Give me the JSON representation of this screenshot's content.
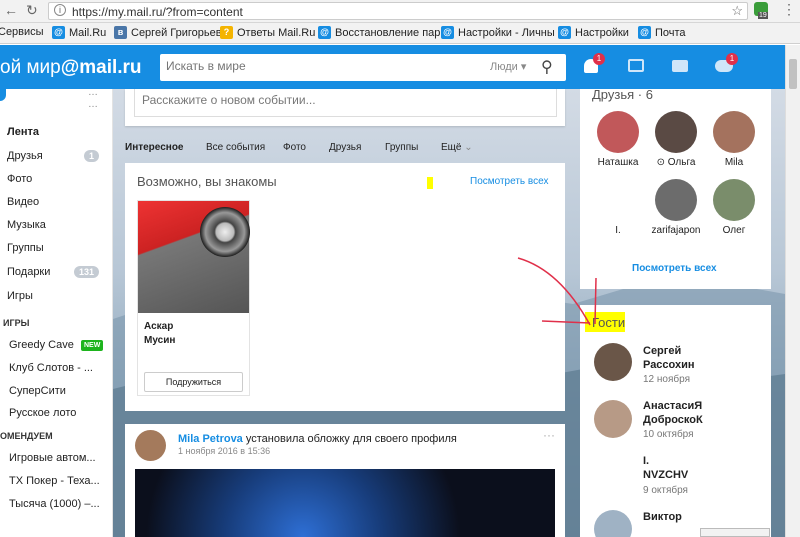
{
  "browser": {
    "url": "https://my.mail.ru/?from=content",
    "bookmarks": [
      "Сервисы",
      "Mail.Ru",
      "Сергей Григорьев",
      "Ответы Mail.Ru",
      "Восстановление пар",
      "Настройки - Личны",
      "Настройки",
      "Почта"
    ],
    "ext_count": "19"
  },
  "header": {
    "logo_prefix": "ой мир",
    "logo_mail": "@mail.ru",
    "search_placeholder": "Искать в мире",
    "search_scope": "Люди",
    "notif_count": "1",
    "games_count": "1"
  },
  "sidebar": {
    "items": [
      {
        "label": "Лента",
        "badge": ""
      },
      {
        "label": "Друзья",
        "badge": "1"
      },
      {
        "label": "Фото",
        "badge": ""
      },
      {
        "label": "Видео",
        "badge": ""
      },
      {
        "label": "Музыка",
        "badge": ""
      },
      {
        "label": "Группы",
        "badge": ""
      },
      {
        "label": "Подарки",
        "badge": "131"
      },
      {
        "label": "Игры",
        "badge": ""
      }
    ],
    "games_header": "ИГРЫ",
    "games": [
      "Greedy Cave",
      "Клуб Слотов - ...",
      "СуперСити",
      "Русское лото"
    ],
    "new_badge": "NEW",
    "recommend_header": "ОМЕНДУЕМ",
    "recommend": [
      "Игровые автом...",
      "ТХ Покер - Теха...",
      "Тысяча (1000) –..."
    ]
  },
  "composer": {
    "placeholder": "Расскажите о новом событии..."
  },
  "tabs": [
    "Интересное",
    "Все события",
    "Фото",
    "Друзья",
    "Группы",
    "Ещё"
  ],
  "maybe_known": {
    "title": "Возможно, вы знакомы",
    "see_all": "Посмотреть всех",
    "person_first": "Аскар",
    "person_last": "Мусин",
    "join_button": "Подружиться"
  },
  "post": {
    "author": "Mila Petrova",
    "action": "установила обложку для своего профиля",
    "date": "1 ноября 2016 в 15:36"
  },
  "friends": {
    "title": "Друзья",
    "count": "6",
    "list": [
      "Наташка",
      "Ольга",
      "Mila",
      "I.",
      "zarifajapon",
      "Олег"
    ],
    "see_all": "Посмотреть всех"
  },
  "guests": {
    "title": "Гости",
    "list": [
      {
        "name1": "Сергей",
        "name2": "Рассохин",
        "date": "12 ноября"
      },
      {
        "name1": "АнастасиЯ",
        "name2": "ДоброскоК",
        "date": "10 октября"
      },
      {
        "name1": "I.",
        "name2": "NVZCHV",
        "date": "9 октября"
      },
      {
        "name1": "Виктор",
        "name2": "",
        "date": ""
      }
    ]
  },
  "colors": {
    "header": "#168de2",
    "link": "#168de2",
    "accent_red": "#e0304a",
    "new_green": "#1db41d",
    "highlight": "#ffff00"
  }
}
